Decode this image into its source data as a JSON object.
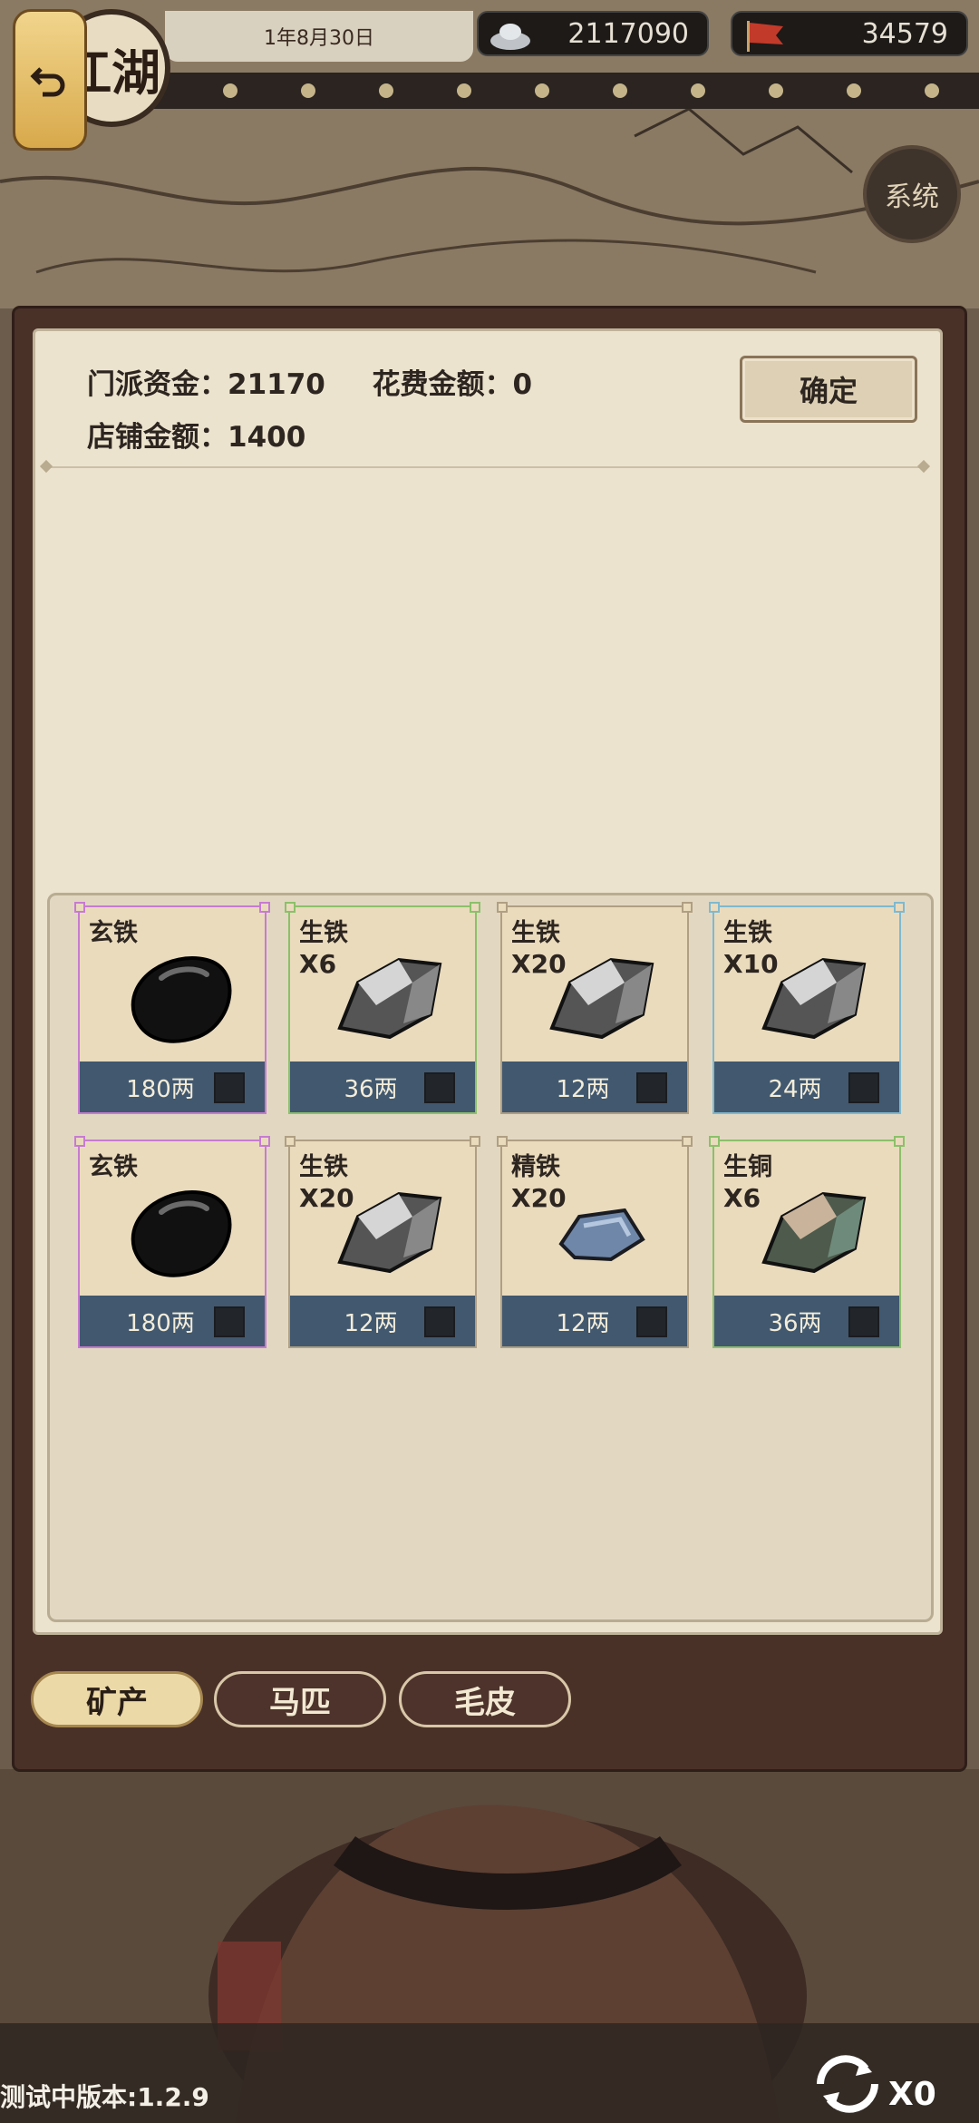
{
  "top_bar": {
    "date": "1年8月30日",
    "silver": "2117090",
    "reputation": "34579",
    "region_badge": "江湖",
    "system_label": "系统"
  },
  "dialog": {
    "sect_funds_label": "门派资金：",
    "sect_funds": "21170",
    "cost_label": "花费金额：",
    "cost": "0",
    "shop_amount_label": "店铺金额：",
    "shop_amount": "1400",
    "confirm_label": "确定"
  },
  "items": [
    {
      "name": "玄铁",
      "qty": "",
      "price": "180两",
      "icon": "black-iron-icon",
      "rarity_color": "#c77bd1"
    },
    {
      "name": "生铁",
      "qty": "X6",
      "price": "36两",
      "icon": "pig-iron-icon",
      "rarity_color": "#8cc06a"
    },
    {
      "name": "生铁",
      "qty": "X20",
      "price": "12两",
      "icon": "pig-iron-icon",
      "rarity_color": "#b09f83"
    },
    {
      "name": "生铁",
      "qty": "X10",
      "price": "24两",
      "icon": "pig-iron-icon",
      "rarity_color": "#7fb9cf"
    },
    {
      "name": "玄铁",
      "qty": "",
      "price": "180两",
      "icon": "black-iron-icon",
      "rarity_color": "#c77bd1"
    },
    {
      "name": "生铁",
      "qty": "X20",
      "price": "12两",
      "icon": "pig-iron-icon",
      "rarity_color": "#b09f83"
    },
    {
      "name": "精铁",
      "qty": "X20",
      "price": "12两",
      "icon": "refined-iron-icon",
      "rarity_color": "#b09f83"
    },
    {
      "name": "生铜",
      "qty": "X6",
      "price": "36两",
      "icon": "raw-copper-icon",
      "rarity_color": "#8cc06a"
    }
  ],
  "tabs": [
    {
      "label": "矿产",
      "active": true
    },
    {
      "label": "马匹",
      "active": false
    },
    {
      "label": "毛皮",
      "active": false
    }
  ],
  "footer": {
    "version": "测试中版本:1.2.9",
    "refresh_count": "X0"
  },
  "colors": {
    "price_bar": "#41586f",
    "panel": "#ece3ce",
    "frame": "#4a3128"
  }
}
